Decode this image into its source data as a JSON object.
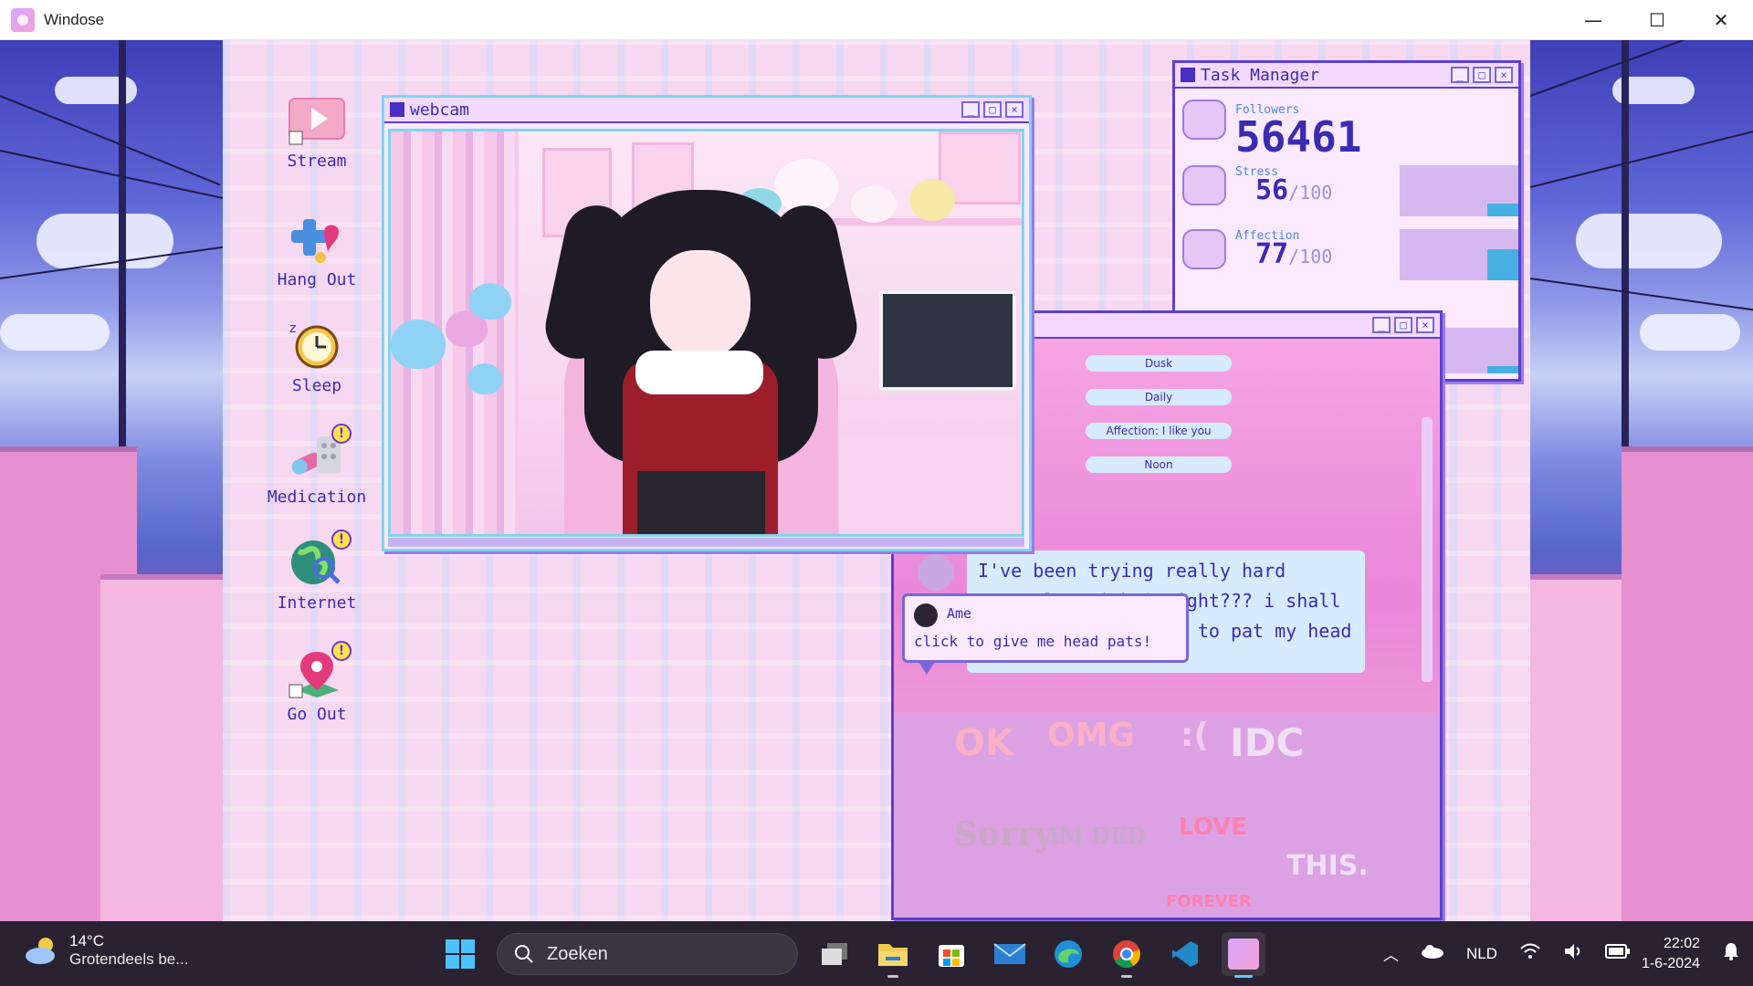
{
  "os": {
    "title": "Windose",
    "controls": {
      "minimize": "—",
      "maximize": "☐",
      "close": "✕"
    }
  },
  "desktop_icons": [
    {
      "label": "Stream",
      "icon": "stream-icon"
    },
    {
      "label": "Hang Out",
      "icon": "hangout-icon"
    },
    {
      "label": "Sleep",
      "icon": "alarm-clock-icon"
    },
    {
      "label": "Medication",
      "icon": "pills-icon"
    },
    {
      "label": "Internet",
      "icon": "globe-icon"
    },
    {
      "label": "Go Out",
      "icon": "map-pin-icon"
    }
  ],
  "webcam": {
    "title": "webcam"
  },
  "task_manager": {
    "title": "Task Manager",
    "followers": {
      "label": "Followers",
      "value": "56461"
    },
    "stress": {
      "label": "Stress",
      "value": "56",
      "max": "/100",
      "level": 0.56
    },
    "affection": {
      "label": "Affection",
      "value": "77",
      "max": "/100",
      "level": 0.77
    }
  },
  "chat": {
    "pills": [
      "Dusk",
      "Daily",
      "Affection: I like you",
      "Noon"
    ],
    "message": "I've been trying really hard recently! right? right??? i shall give you permission to pat my head",
    "stickers": [
      "OK",
      "OMG",
      ":(",
      "IDC",
      "Sorry",
      "IM DED",
      "LOVE",
      "FOREVER",
      "THIS."
    ]
  },
  "bubble": {
    "name": "Ame",
    "text": "click to give me head pats!"
  },
  "taskbar": {
    "weather_temp": "14°C",
    "weather_desc": "Grotendeels be...",
    "search_placeholder": "Zoeken",
    "language": "NLD",
    "time": "22:02",
    "date": "1-6-2024"
  },
  "colors": {
    "accent": "#5b3fd0",
    "text": "#3b2bb2",
    "bar": "#47b0e2"
  }
}
